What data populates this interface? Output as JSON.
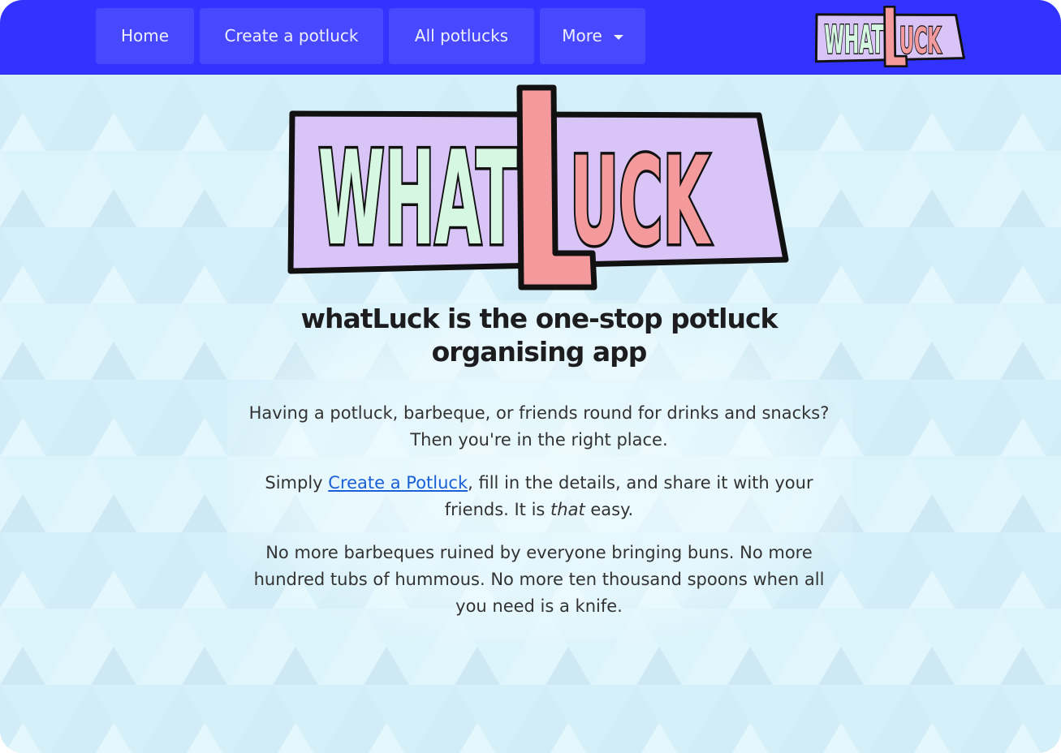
{
  "nav": {
    "home_label": "Home",
    "create_label": "Create a potluck",
    "all_label": "All potlucks",
    "more_label": "More"
  },
  "logo": {
    "text_what": "WHAT",
    "text_l": "L",
    "text_uck": "UCK"
  },
  "main": {
    "headline": "whatLuck is the one-stop potluck organising app",
    "paragraph1": "Having a potluck, barbeque, or friends round for drinks and snacks? Then you're in the right place.",
    "paragraph2_prefix": "Simply ",
    "paragraph2_link": "Create a Potluck",
    "paragraph2_mid": ", fill in the details, and share it with your friends. It is ",
    "paragraph2_em": "that",
    "paragraph2_suffix": " easy.",
    "paragraph3": "No more barbeques ruined by everyone bringing buns. No more hundred tubs of hummous. No more ten thousand spoons when all you need is a knife."
  },
  "colors": {
    "navbar": "#3333ff",
    "nav_button": "#4848ff",
    "background": "#daf3fb",
    "logo_panel": "#d8c4f7",
    "logo_what": "#d6f7e1",
    "logo_luck": "#f49a9c",
    "link": "#1a5fd6"
  },
  "icons": {
    "more_dropdown": "caret-down-icon"
  }
}
